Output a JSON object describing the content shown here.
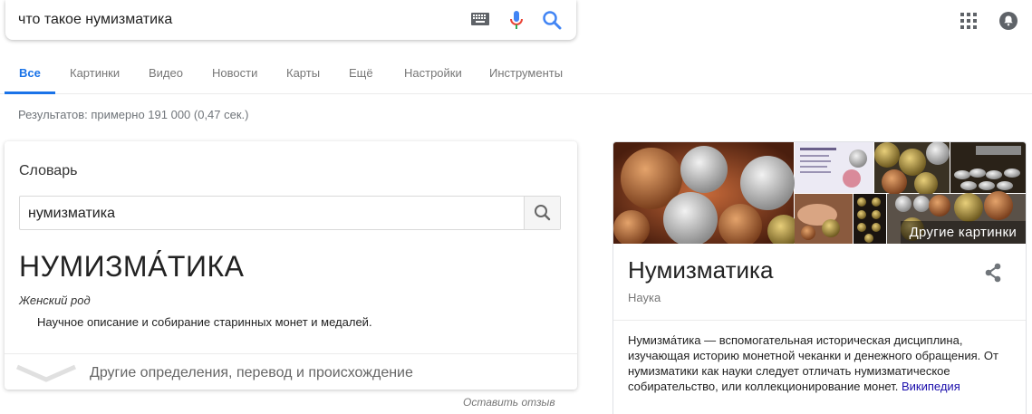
{
  "search": {
    "query": "что такое нумизматика"
  },
  "tabs": [
    {
      "label": "Все",
      "active": true
    },
    {
      "label": "Картинки"
    },
    {
      "label": "Видео"
    },
    {
      "label": "Новости"
    },
    {
      "label": "Карты"
    },
    {
      "label": "Ещё"
    },
    {
      "label": "Настройки"
    },
    {
      "label": "Инструменты"
    }
  ],
  "results_count": "Результатов: примерно 191 000 (0,47 сек.)",
  "dictionary": {
    "title": "Словарь",
    "input_value": "нумизматика",
    "word": "НУМИЗМА́ТИКА",
    "part_of_speech": "Женский род",
    "definition": "Научное описание и собирание старинных монет и медалей.",
    "more_label": "Другие определения, перевод и происхождение",
    "feedback": "Оставить отзыв"
  },
  "knowledge_panel": {
    "more_images": "Другие картинки",
    "title": "Нумизматика",
    "subtitle": "Наука",
    "description": "Нумизма́тика — вспомогательная историческая дисциплина, изучающая историю монетной чеканки и денежного обращения. От нумизматики как науки следует отличать нумизматическое собирательство, или коллекционирование монет.",
    "source_link": "Википедия"
  },
  "colors": {
    "accent": "#1a73e8",
    "link": "#1a0dab",
    "mic_red": "#ea4335"
  }
}
